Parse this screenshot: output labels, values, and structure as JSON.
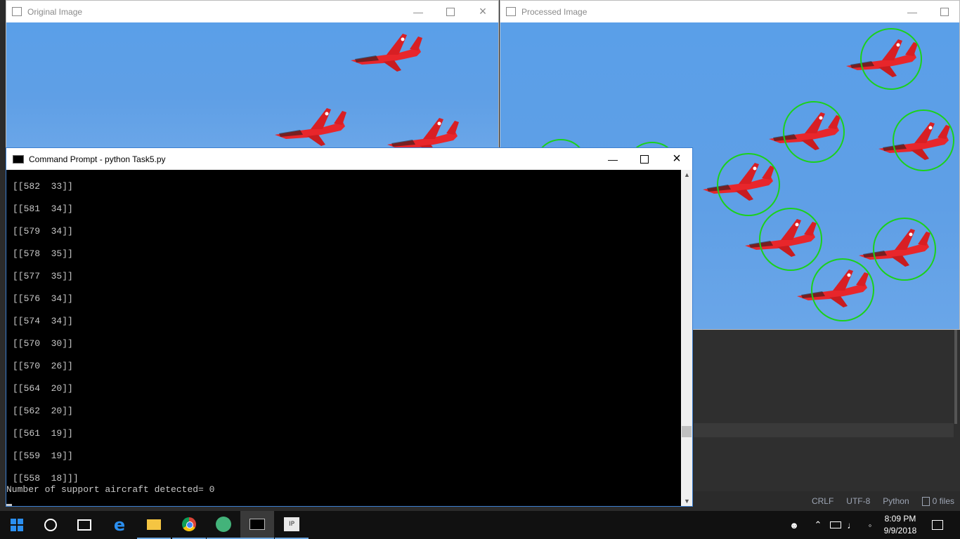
{
  "window_original": {
    "title": "Original Image",
    "icon": "image-window-icon"
  },
  "window_processed": {
    "title": "Processed Image",
    "icon": "image-window-icon"
  },
  "cmd": {
    "title": "Command Prompt - python  Task5.py",
    "lines": [
      "[[582  33]]",
      "[[581  34]]",
      "[[579  34]]",
      "[[578  35]]",
      "[[577  35]]",
      "[[576  34]]",
      "[[574  34]]",
      "[[570  30]]",
      "[[570  26]]",
      "[[564  20]]",
      "[[562  20]]",
      "[[561  19]]",
      "[[559  19]]",
      "[[558  18]]]"
    ],
    "result_line": "Number of support aircraft detected= 0"
  },
  "editor_status": {
    "line_ending": "CRLF",
    "encoding": "UTF-8",
    "language": "Python",
    "files": "0 files"
  },
  "taskbar": {
    "apps": [
      "start-icon",
      "cortana-icon",
      "task-view-icon",
      "edge-icon",
      "file-explorer-icon",
      "chrome-icon",
      "atom-icon",
      "command-prompt-icon",
      "ipython-icon"
    ],
    "time": "8:09 PM",
    "date": "9/9/2018"
  },
  "colors": {
    "sky": "#5f9fe6",
    "jet": "#e8262b",
    "detection_circle": "#1bd11b",
    "console_bg": "#000000"
  }
}
